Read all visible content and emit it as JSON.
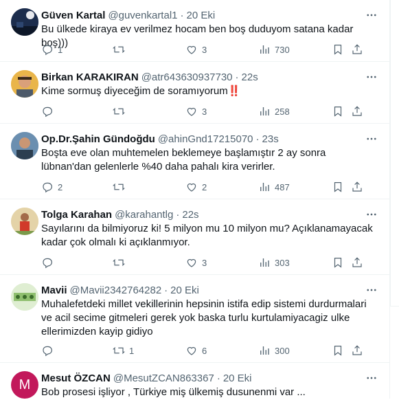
{
  "tweets": [
    {
      "name": "Güven Kartal",
      "handle": "@guvenkartal1",
      "time": "20 Eki",
      "text": "Bu ülkede kiraya ev verilmez hocam ben boş duduyom satana kadar boş)))",
      "replies": "1",
      "retweets": "",
      "likes": "3",
      "views": "730"
    },
    {
      "name": "Birkan KARAKIRAN",
      "handle": "@atr643630937730",
      "time": "22s",
      "text": "Kime sormuş diyeceğim de soramıyorum",
      "emoji": "‼️",
      "replies": "",
      "retweets": "",
      "likes": "3",
      "views": "258"
    },
    {
      "name": "Op.Dr.Şahin Gündoğdu",
      "handle": "@ahinGnd17215070",
      "time": "23s",
      "text": "Boşta eve olan muhtemelen beklemeye başlamıştır 2 ay sonra lübnan'dan gelenlerle %40 daha pahalı kira verirler.",
      "replies": "2",
      "retweets": "",
      "likes": "2",
      "views": "487"
    },
    {
      "name": "Tolga Karahan",
      "handle": "@karahantlg",
      "time": "22s",
      "text": "Sayılarını da bilmiyoruz ki! 5 milyon mu 10 milyon mu? Açıklanamayacak kadar çok olmalı ki açıklanmıyor.",
      "replies": "",
      "retweets": "",
      "likes": "3",
      "views": "303"
    },
    {
      "name": "Mavii",
      "handle": "@Mavii2342764282",
      "time": "20 Eki",
      "text": "Muhalefetdeki millet vekillerinin hepsinin istifa edip sistemi durdurmalari ve acil secime gitmeleri gerek yok baska turlu kurtulamiyacagiz ulke ellerimizden kayip gidiyo",
      "replies": "",
      "retweets": "1",
      "likes": "6",
      "views": "300"
    },
    {
      "name": "Mesut ÖZCAN",
      "handle": "@MesutZCAN863367",
      "time": "20 Eki",
      "text": "Bob prosesi işliyor , Türkiye miş  ülkemiş dusunenmi var ...",
      "avatar_letter": "M",
      "avatar_color": "#c2185b"
    }
  ],
  "icons": {
    "reply": "reply-icon",
    "retweet": "retweet-icon",
    "like": "like-icon",
    "views": "views-icon",
    "bookmark": "bookmark-icon",
    "share": "share-icon",
    "more": "more-icon"
  },
  "colors": {
    "text": "#0f1419",
    "secondary": "#536471",
    "border": "#eff3f4",
    "alert": "#f4212e"
  }
}
